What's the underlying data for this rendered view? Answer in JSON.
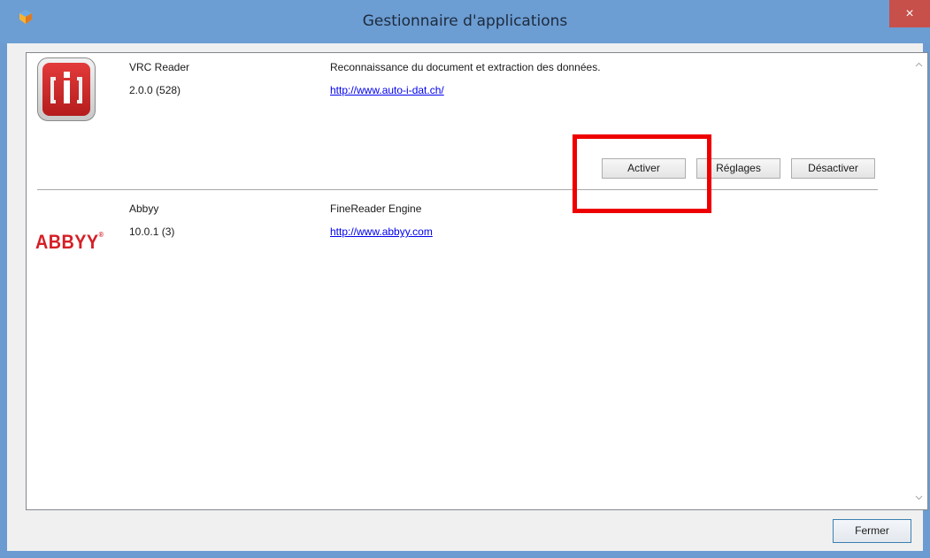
{
  "window": {
    "title": "Gestionnaire d'applications",
    "close_label": "×"
  },
  "apps": [
    {
      "name": "VRC Reader",
      "version": "2.0.0 (528)",
      "description": "Reconnaissance du document et extraction des données.",
      "link": "http://www.auto-i-dat.ch/",
      "logo": "vrc-reader-logo",
      "buttons": {
        "activate": "Activer",
        "settings": "Réglages",
        "deactivate": "Désactiver"
      }
    },
    {
      "name": "Abbyy",
      "version": "10.0.1 (3)",
      "description": "FineReader Engine",
      "link": "http://www.abbyy.com",
      "logo_text": "ABBYY",
      "logo_mark": "®"
    }
  ],
  "footer": {
    "close_button": "Fermer"
  },
  "colors": {
    "titlebar": "#6c9dd3",
    "close": "#c7504a",
    "highlight": "#ee0000",
    "abbyy_red": "#d51f26"
  },
  "scrollbar": {
    "up_icon": "chevron-up-icon",
    "down_icon": "chevron-down-icon"
  }
}
